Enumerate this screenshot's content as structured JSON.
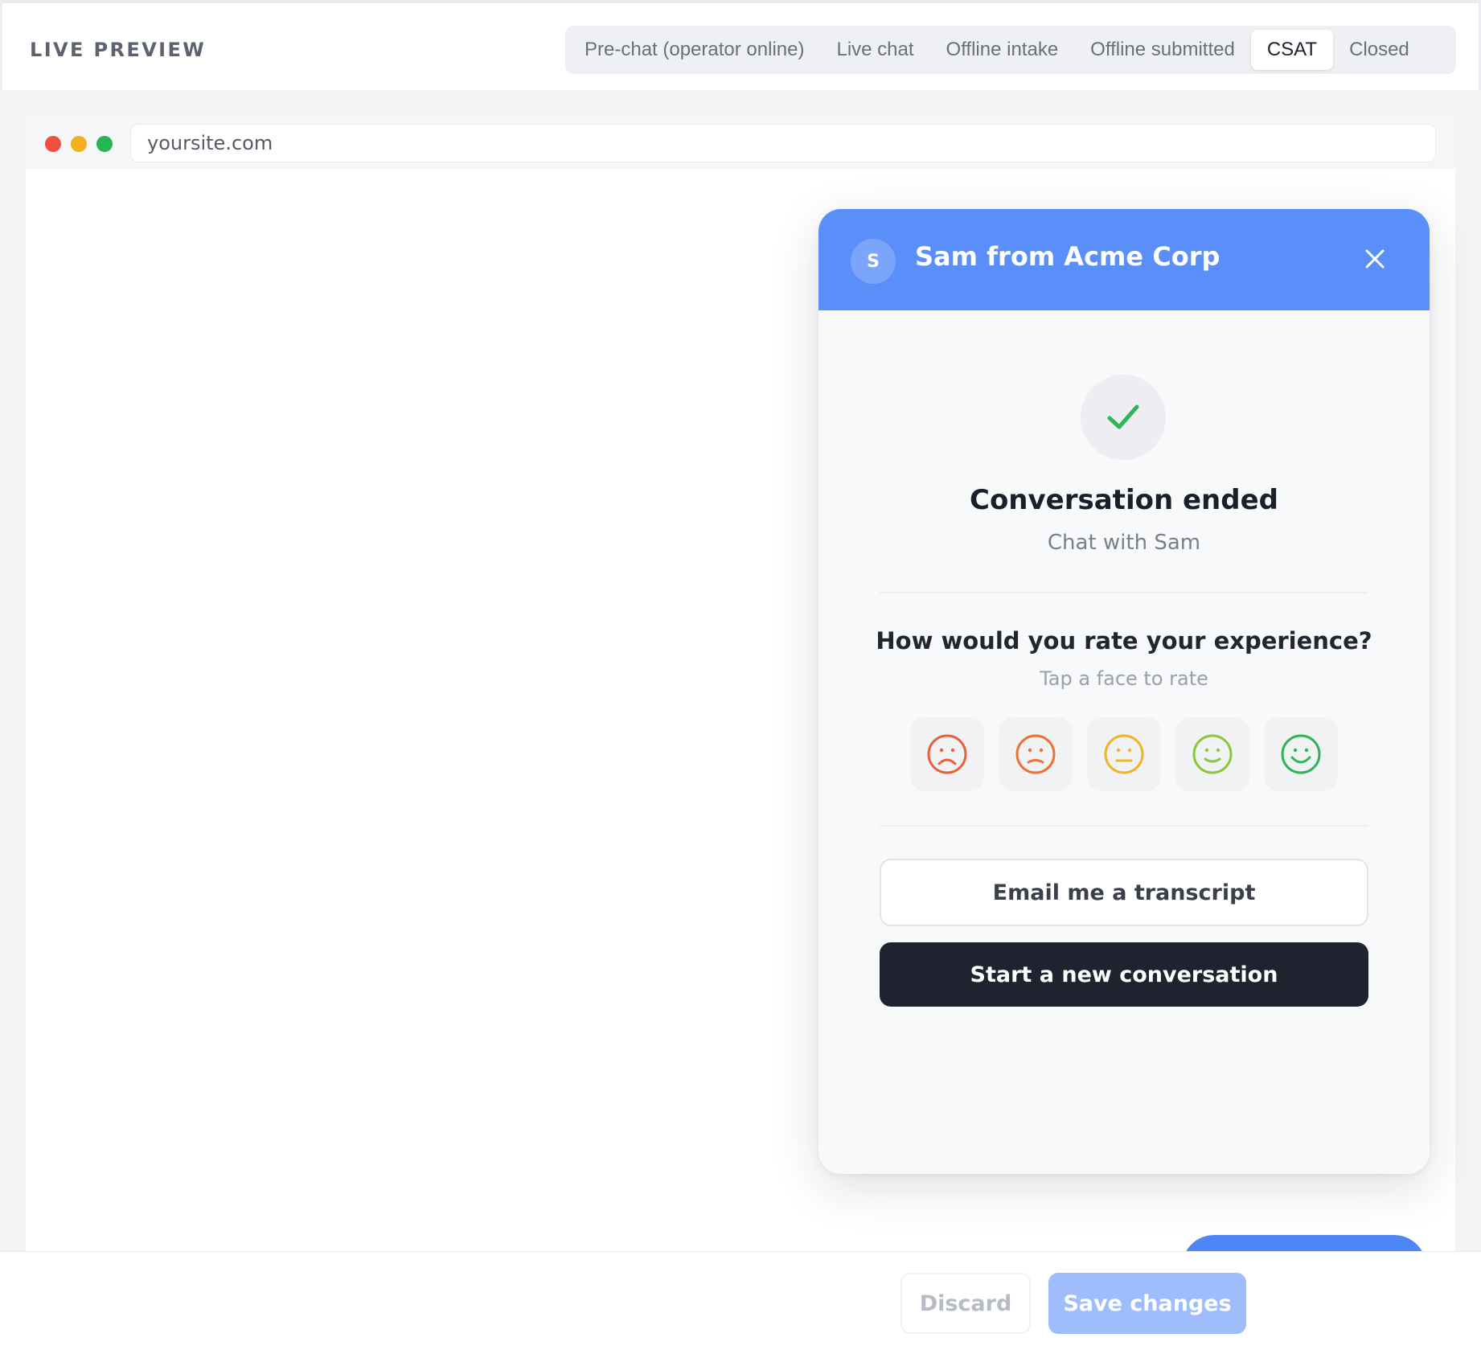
{
  "header": {
    "title": "LIVE PREVIEW",
    "tabs": [
      {
        "label": "Pre-chat (operator online)",
        "active": false
      },
      {
        "label": "Live chat",
        "active": false
      },
      {
        "label": "Offline intake",
        "active": false
      },
      {
        "label": "Offline submitted",
        "active": false
      },
      {
        "label": "CSAT",
        "active": true
      },
      {
        "label": "Closed",
        "active": false
      }
    ]
  },
  "browser": {
    "url": "yoursite.com",
    "traffic_lights": [
      "#ef4f3e",
      "#f2b01e",
      "#27b552"
    ]
  },
  "widget": {
    "avatar_initial": "S",
    "agent_name": "Sam from Acme Corp",
    "header_color": "#5a8ffa",
    "status_icon": "check-icon",
    "ended_title": "Conversation ended",
    "ended_subtitle": "Chat with Sam",
    "rating_question": "How would you rate your experience?",
    "rating_hint": "Tap a face to rate",
    "faces": [
      {
        "icon": "very-sad-face-icon",
        "color": "#e8603c"
      },
      {
        "icon": "sad-face-icon",
        "color": "#ec7233"
      },
      {
        "icon": "neutral-face-icon",
        "color": "#f0b429"
      },
      {
        "icon": "happy-face-icon",
        "color": "#8cc63e"
      },
      {
        "icon": "very-happy-face-icon",
        "color": "#2fb457"
      }
    ],
    "email_transcript_label": "Email me a transcript",
    "new_conversation_label": "Start a new conversation"
  },
  "footer": {
    "discard_label": "Discard",
    "save_label": "Save changes"
  }
}
